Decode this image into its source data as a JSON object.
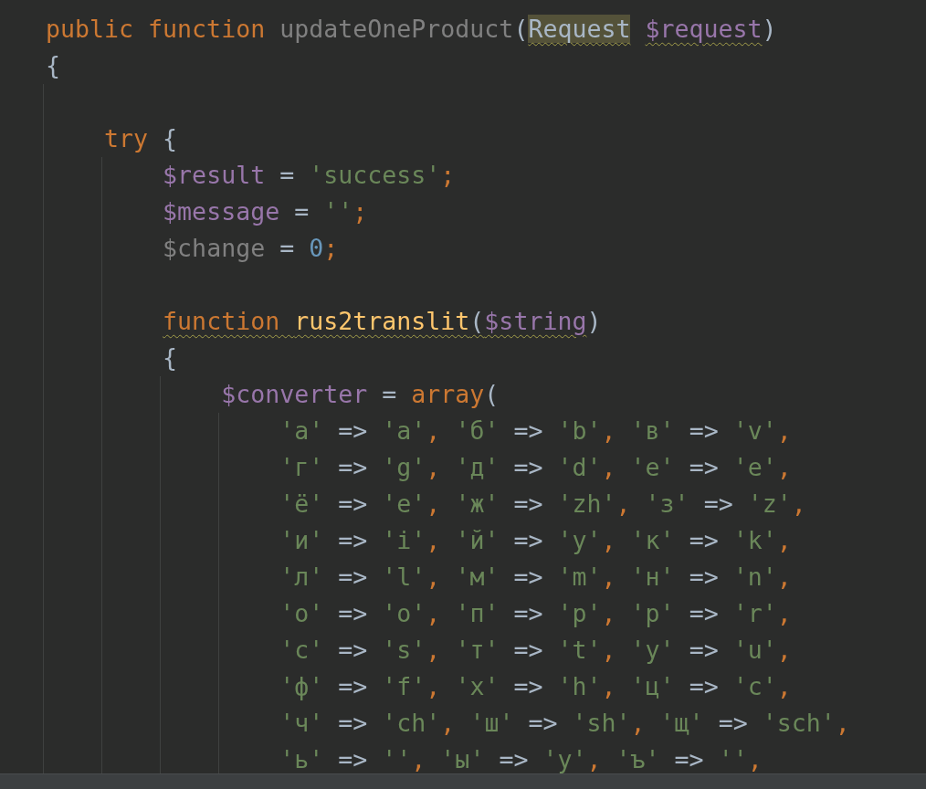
{
  "editor": {
    "lines": [
      {
        "kind": "code",
        "tokens": [
          {
            "text": "public function ",
            "kind": "keyword"
          },
          {
            "text": "updateOneProduct",
            "kind": "unused"
          },
          {
            "text": "(",
            "kind": "plain"
          },
          {
            "text": "Request",
            "kind": "plain",
            "highlighted": true,
            "warning": true
          },
          {
            "text": " $request",
            "kind": "variable",
            "warning": true
          },
          {
            "text": ")",
            "kind": "plain"
          }
        ]
      },
      {
        "kind": "code",
        "tokens": [
          {
            "text": "{",
            "kind": "plain"
          }
        ]
      },
      {
        "kind": "blank"
      },
      {
        "kind": "code",
        "tokens": [
          {
            "text": "    try ",
            "kind": "keyword"
          },
          {
            "text": "{",
            "kind": "plain"
          }
        ]
      },
      {
        "kind": "code",
        "tokens": [
          {
            "text": "        $result",
            "kind": "variable"
          },
          {
            "text": " = ",
            "kind": "plain"
          },
          {
            "text": "'success'",
            "kind": "string"
          },
          {
            "text": ";",
            "kind": "keyword"
          }
        ]
      },
      {
        "kind": "code",
        "tokens": [
          {
            "text": "        $message",
            "kind": "variable"
          },
          {
            "text": " = ",
            "kind": "plain"
          },
          {
            "text": "''",
            "kind": "string"
          },
          {
            "text": ";",
            "kind": "keyword"
          }
        ]
      },
      {
        "kind": "code",
        "tokens": [
          {
            "text": "        $change",
            "kind": "unused"
          },
          {
            "text": " = ",
            "kind": "plain"
          },
          {
            "text": "0",
            "kind": "number"
          },
          {
            "text": ";",
            "kind": "keyword"
          }
        ]
      },
      {
        "kind": "blank"
      },
      {
        "kind": "code",
        "tokens": [
          {
            "text": "        function ",
            "kind": "keyword",
            "warning": true
          },
          {
            "text": "rus2translit",
            "kind": "function",
            "warning": true
          },
          {
            "text": "(",
            "kind": "plain",
            "warning": true
          },
          {
            "text": "$string",
            "kind": "variable",
            "warning": true
          },
          {
            "text": ")",
            "kind": "plain"
          }
        ]
      },
      {
        "kind": "code",
        "tokens": [
          {
            "text": "        {",
            "kind": "plain"
          }
        ]
      },
      {
        "kind": "code",
        "tokens": [
          {
            "text": "            $converter",
            "kind": "variable"
          },
          {
            "text": " = ",
            "kind": "plain"
          },
          {
            "text": "array",
            "kind": "keyword"
          },
          {
            "text": "(",
            "kind": "plain"
          }
        ]
      },
      {
        "kind": "code",
        "tokens": [
          {
            "text": "                'а'",
            "kind": "string"
          },
          {
            "text": " => ",
            "kind": "plain"
          },
          {
            "text": "'a'",
            "kind": "string"
          },
          {
            "text": ", ",
            "kind": "keyword"
          },
          {
            "text": "'б'",
            "kind": "string"
          },
          {
            "text": " => ",
            "kind": "plain"
          },
          {
            "text": "'b'",
            "kind": "string"
          },
          {
            "text": ", ",
            "kind": "keyword"
          },
          {
            "text": "'в'",
            "kind": "string"
          },
          {
            "text": " => ",
            "kind": "plain"
          },
          {
            "text": "'v'",
            "kind": "string"
          },
          {
            "text": ",",
            "kind": "keyword"
          }
        ]
      },
      {
        "kind": "code",
        "tokens": [
          {
            "text": "                'г'",
            "kind": "string"
          },
          {
            "text": " => ",
            "kind": "plain"
          },
          {
            "text": "'g'",
            "kind": "string"
          },
          {
            "text": ", ",
            "kind": "keyword"
          },
          {
            "text": "'д'",
            "kind": "string"
          },
          {
            "text": " => ",
            "kind": "plain"
          },
          {
            "text": "'d'",
            "kind": "string"
          },
          {
            "text": ", ",
            "kind": "keyword"
          },
          {
            "text": "'е'",
            "kind": "string"
          },
          {
            "text": " => ",
            "kind": "plain"
          },
          {
            "text": "'e'",
            "kind": "string"
          },
          {
            "text": ",",
            "kind": "keyword"
          }
        ]
      },
      {
        "kind": "code",
        "tokens": [
          {
            "text": "                'ё'",
            "kind": "string"
          },
          {
            "text": " => ",
            "kind": "plain"
          },
          {
            "text": "'e'",
            "kind": "string"
          },
          {
            "text": ", ",
            "kind": "keyword"
          },
          {
            "text": "'ж'",
            "kind": "string"
          },
          {
            "text": " => ",
            "kind": "plain"
          },
          {
            "text": "'zh'",
            "kind": "string"
          },
          {
            "text": ", ",
            "kind": "keyword"
          },
          {
            "text": "'з'",
            "kind": "string"
          },
          {
            "text": " => ",
            "kind": "plain"
          },
          {
            "text": "'z'",
            "kind": "string"
          },
          {
            "text": ",",
            "kind": "keyword"
          }
        ]
      },
      {
        "kind": "code",
        "tokens": [
          {
            "text": "                'и'",
            "kind": "string"
          },
          {
            "text": " => ",
            "kind": "plain"
          },
          {
            "text": "'i'",
            "kind": "string"
          },
          {
            "text": ", ",
            "kind": "keyword"
          },
          {
            "text": "'й'",
            "kind": "string"
          },
          {
            "text": " => ",
            "kind": "plain"
          },
          {
            "text": "'y'",
            "kind": "string"
          },
          {
            "text": ", ",
            "kind": "keyword"
          },
          {
            "text": "'к'",
            "kind": "string"
          },
          {
            "text": " => ",
            "kind": "plain"
          },
          {
            "text": "'k'",
            "kind": "string"
          },
          {
            "text": ",",
            "kind": "keyword"
          }
        ]
      },
      {
        "kind": "code",
        "tokens": [
          {
            "text": "                'л'",
            "kind": "string"
          },
          {
            "text": " => ",
            "kind": "plain"
          },
          {
            "text": "'l'",
            "kind": "string"
          },
          {
            "text": ", ",
            "kind": "keyword"
          },
          {
            "text": "'м'",
            "kind": "string"
          },
          {
            "text": " => ",
            "kind": "plain"
          },
          {
            "text": "'m'",
            "kind": "string"
          },
          {
            "text": ", ",
            "kind": "keyword"
          },
          {
            "text": "'н'",
            "kind": "string"
          },
          {
            "text": " => ",
            "kind": "plain"
          },
          {
            "text": "'n'",
            "kind": "string"
          },
          {
            "text": ",",
            "kind": "keyword"
          }
        ]
      },
      {
        "kind": "code",
        "tokens": [
          {
            "text": "                'о'",
            "kind": "string"
          },
          {
            "text": " => ",
            "kind": "plain"
          },
          {
            "text": "'o'",
            "kind": "string"
          },
          {
            "text": ", ",
            "kind": "keyword"
          },
          {
            "text": "'п'",
            "kind": "string"
          },
          {
            "text": " => ",
            "kind": "plain"
          },
          {
            "text": "'p'",
            "kind": "string"
          },
          {
            "text": ", ",
            "kind": "keyword"
          },
          {
            "text": "'р'",
            "kind": "string"
          },
          {
            "text": " => ",
            "kind": "plain"
          },
          {
            "text": "'r'",
            "kind": "string"
          },
          {
            "text": ",",
            "kind": "keyword"
          }
        ]
      },
      {
        "kind": "code",
        "tokens": [
          {
            "text": "                'с'",
            "kind": "string"
          },
          {
            "text": " => ",
            "kind": "plain"
          },
          {
            "text": "'s'",
            "kind": "string"
          },
          {
            "text": ", ",
            "kind": "keyword"
          },
          {
            "text": "'т'",
            "kind": "string"
          },
          {
            "text": " => ",
            "kind": "plain"
          },
          {
            "text": "'t'",
            "kind": "string"
          },
          {
            "text": ", ",
            "kind": "keyword"
          },
          {
            "text": "'у'",
            "kind": "string"
          },
          {
            "text": " => ",
            "kind": "plain"
          },
          {
            "text": "'u'",
            "kind": "string"
          },
          {
            "text": ",",
            "kind": "keyword"
          }
        ]
      },
      {
        "kind": "code",
        "tokens": [
          {
            "text": "                'ф'",
            "kind": "string"
          },
          {
            "text": " => ",
            "kind": "plain"
          },
          {
            "text": "'f'",
            "kind": "string"
          },
          {
            "text": ", ",
            "kind": "keyword"
          },
          {
            "text": "'х'",
            "kind": "string"
          },
          {
            "text": " => ",
            "kind": "plain"
          },
          {
            "text": "'h'",
            "kind": "string"
          },
          {
            "text": ", ",
            "kind": "keyword"
          },
          {
            "text": "'ц'",
            "kind": "string"
          },
          {
            "text": " => ",
            "kind": "plain"
          },
          {
            "text": "'c'",
            "kind": "string"
          },
          {
            "text": ",",
            "kind": "keyword"
          }
        ]
      },
      {
        "kind": "code",
        "tokens": [
          {
            "text": "                'ч'",
            "kind": "string"
          },
          {
            "text": " => ",
            "kind": "plain"
          },
          {
            "text": "'ch'",
            "kind": "string"
          },
          {
            "text": ", ",
            "kind": "keyword"
          },
          {
            "text": "'ш'",
            "kind": "string"
          },
          {
            "text": " => ",
            "kind": "plain"
          },
          {
            "text": "'sh'",
            "kind": "string"
          },
          {
            "text": ", ",
            "kind": "keyword"
          },
          {
            "text": "'щ'",
            "kind": "string"
          },
          {
            "text": " => ",
            "kind": "plain"
          },
          {
            "text": "'sch'",
            "kind": "string"
          },
          {
            "text": ",",
            "kind": "keyword"
          }
        ]
      },
      {
        "kind": "code",
        "tokens": [
          {
            "text": "                'ь'",
            "kind": "string"
          },
          {
            "text": " => ",
            "kind": "plain"
          },
          {
            "text": "''",
            "kind": "string"
          },
          {
            "text": ", ",
            "kind": "keyword"
          },
          {
            "text": "'ы'",
            "kind": "string"
          },
          {
            "text": " => ",
            "kind": "plain"
          },
          {
            "text": "'y'",
            "kind": "string"
          },
          {
            "text": ", ",
            "kind": "keyword"
          },
          {
            "text": "'ъ'",
            "kind": "string"
          },
          {
            "text": " => ",
            "kind": "plain"
          },
          {
            "text": "''",
            "kind": "string"
          },
          {
            "text": ",",
            "kind": "keyword"
          }
        ]
      }
    ]
  }
}
